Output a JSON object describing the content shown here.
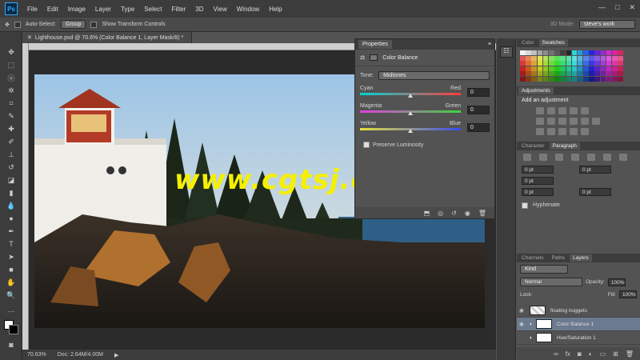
{
  "app": {
    "logo": "Ps"
  },
  "menu": [
    "File",
    "Edit",
    "Image",
    "Layer",
    "Type",
    "Select",
    "Filter",
    "3D",
    "View",
    "Window",
    "Help"
  ],
  "options_bar": {
    "auto_select_label": "Auto-Select:",
    "auto_select_value": "Group",
    "transform_label": "Show Transform Controls",
    "mode_label": "3D Mode:",
    "workspace": "steve's work"
  },
  "document": {
    "tab_title": "Lighthouse.psd @ 70.6% (Color Balance 1, Layer Mask/8) *",
    "zoom": "70.63%",
    "doc_info": "Doc: 2.64M/4.00M",
    "watermark": "www.cgtsj.com"
  },
  "properties": {
    "tab": "Properties",
    "title": "Color Balance",
    "tone_label": "Tone:",
    "tone_value": "Midtones",
    "sliders": [
      {
        "left": "Cyan",
        "right": "Red",
        "value": "0"
      },
      {
        "left": "Magenta",
        "right": "Green",
        "value": "0"
      },
      {
        "left": "Yellow",
        "right": "Blue",
        "value": "0"
      }
    ],
    "preserve": "Preserve Luminosity"
  },
  "right_panels": {
    "color_tabs": [
      "Color",
      "Swatches"
    ],
    "adjustments_title": "Adjustments",
    "adjustments_subtitle": "Add an adjustment",
    "char_tabs": [
      "Character",
      "Paragraph"
    ],
    "para_values": [
      "0 pt",
      "0 pt",
      "0 pt",
      "0 pt",
      "0 pt"
    ],
    "hyphenate": "Hyphenate",
    "layers_tabs": [
      "Channels",
      "Paths",
      "Layers"
    ],
    "kind": "Kind",
    "blend_mode": "Normal",
    "opacity_label": "Opacity:",
    "opacity": "100%",
    "lock_label": "Lock:",
    "fill_label": "Fill:",
    "fill": "100%",
    "layers": [
      {
        "name": "floating nuggets"
      },
      {
        "name": "Color Balance 1"
      },
      {
        "name": "Hue/Saturation 1"
      }
    ]
  },
  "colors": {
    "accent": "#31a8ff",
    "panel": "#535353",
    "dark": "#3c3c3c",
    "watermark": "#f5f000",
    "selected_layer": "#6b7a8f"
  }
}
